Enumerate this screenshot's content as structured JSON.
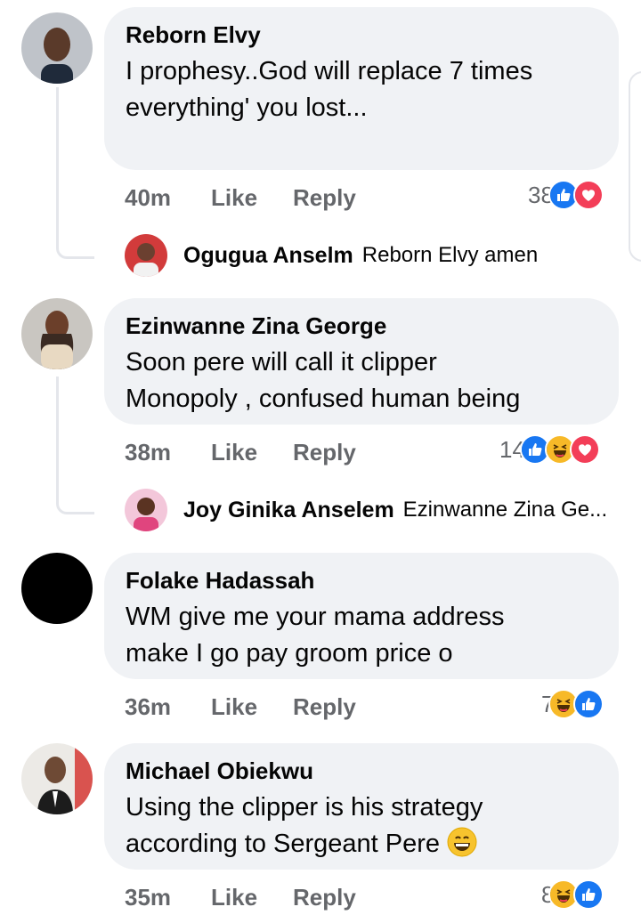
{
  "comments": [
    {
      "author": "Reborn Elvy",
      "text": "I prophesy..God will replace 7 times\neverything' you lost...",
      "time": "40m",
      "like": "Like",
      "reply": "Reply",
      "reaction_count": "38",
      "reactions": [
        "like-icon",
        "love-icon"
      ],
      "reply_preview": {
        "author": "Ogugua Anselm",
        "text": "Reborn Elvy amen"
      }
    },
    {
      "author": "Ezinwanne Zina George",
      "text": "Soon pere will call it clipper\nMonopoly , confused human being",
      "time": "38m",
      "like": "Like",
      "reply": "Reply",
      "reaction_count": "14",
      "reactions": [
        "like-icon",
        "haha-icon",
        "love-icon"
      ],
      "reply_preview": {
        "author": "Joy Ginika Anselem",
        "text": "Ezinwanne Zina Ge..."
      }
    },
    {
      "author": "Folake Hadassah",
      "text": "WM give me your mama address\nmake I go pay groom price o",
      "time": "36m",
      "like": "Like",
      "reply": "Reply",
      "reaction_count": "7",
      "reactions": [
        "haha-icon",
        "like-icon"
      ]
    },
    {
      "author": "Michael Obiekwu",
      "text": "Using the clipper is his strategy\naccording to Sergeant Pere",
      "time": "35m",
      "like": "Like",
      "reply": "Reply",
      "reaction_count": "8",
      "reactions": [
        "haha-icon",
        "like-icon"
      ]
    }
  ],
  "colors": {
    "bubble": "#f0f2f5",
    "meta": "#65676b",
    "like_blue": "#1877f2",
    "love_red": "#f33e58",
    "haha_yellow": "#f7b928"
  }
}
